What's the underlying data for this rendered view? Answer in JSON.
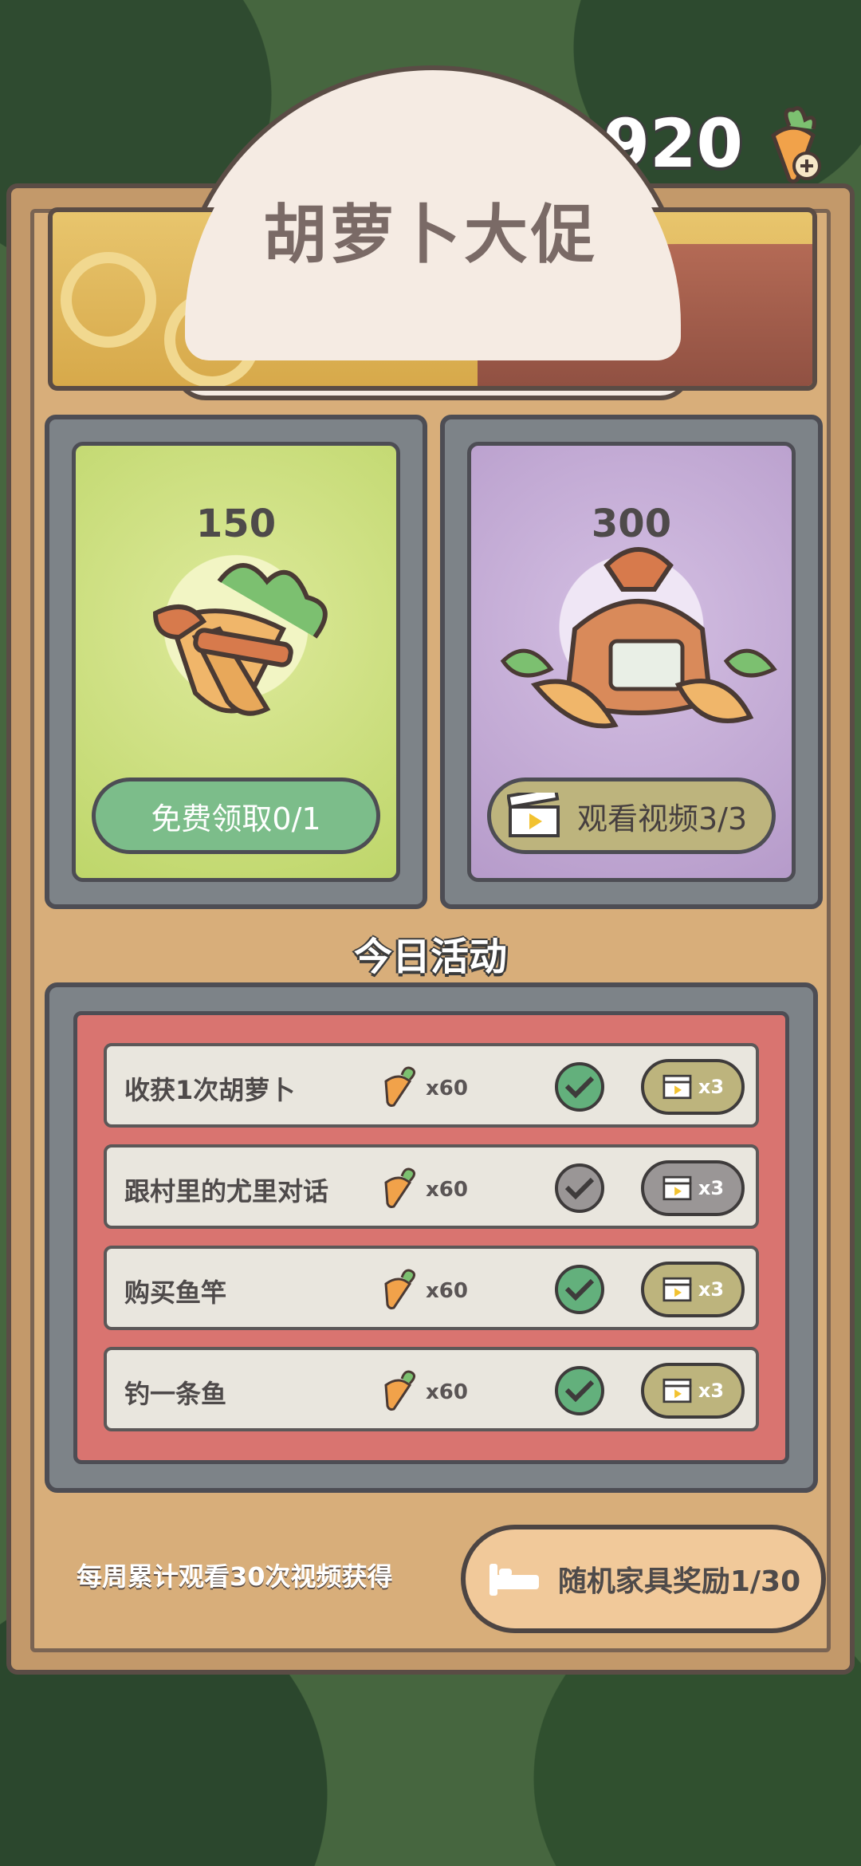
{
  "currency": {
    "amount": "920",
    "icon": "carrot-plus-icon"
  },
  "title": "胡萝卜大促",
  "cards": [
    {
      "price": "150",
      "button_label": "免费领取0/1",
      "icon": "carrot-bundle-icon"
    },
    {
      "price": "300",
      "button_label": "观看视频3/3",
      "icon": "carrot-sack-icon"
    }
  ],
  "section_title": "今日活动",
  "tasks": [
    {
      "label": "收获1次胡萝卜",
      "qty": "x60",
      "done": true,
      "video_label": "x3",
      "video_active": true
    },
    {
      "label": "跟村里的尤里对话",
      "qty": "x60",
      "done": false,
      "video_label": "x3",
      "video_active": false
    },
    {
      "label": "购买鱼竿",
      "qty": "x60",
      "done": true,
      "video_label": "x3",
      "video_active": true
    },
    {
      "label": "钓一条鱼",
      "qty": "x60",
      "done": true,
      "video_label": "x3",
      "video_active": true
    }
  ],
  "weekly_text": "每周累计观看30次视频获得",
  "reward_button_label": "随机家具奖励1/30",
  "colors": {
    "panel": "#c3996a",
    "card_green": "#bed66a",
    "card_purple": "#b69bca",
    "task_bg": "#d97470",
    "check_done": "#63b07c"
  }
}
